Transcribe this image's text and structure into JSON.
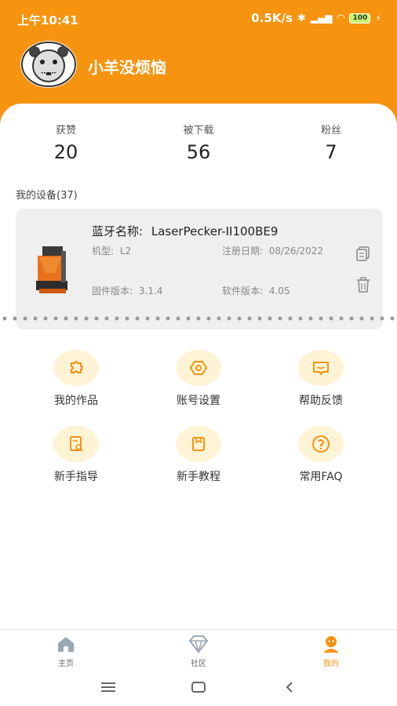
{
  "status_bar": {
    "time": "上午10:41",
    "network_speed": "0.5K/s",
    "battery": "100"
  },
  "profile": {
    "username": "小羊没烦恼"
  },
  "stats": [
    {
      "label": "获赞",
      "value": "20"
    },
    {
      "label": "被下载",
      "value": "56"
    },
    {
      "label": "粉丝",
      "value": "7"
    }
  ],
  "devices": {
    "section_title": "我的设备(37)",
    "card": {
      "bluetooth_label": "蓝牙名称:",
      "bluetooth_name": "LaserPecker-II100BE9",
      "model_label": "机型:",
      "model": "L2",
      "reg_date_label": "注册日期:",
      "reg_date": "08/26/2022",
      "firmware_label": "固件版本:",
      "firmware": "3.1.4",
      "software_label": "软件版本:",
      "software": "4.05"
    }
  },
  "menu": [
    {
      "label": "我的作品",
      "icon": "puzzle-icon"
    },
    {
      "label": "账号设置",
      "icon": "settings-icon"
    },
    {
      "label": "帮助反馈",
      "icon": "feedback-icon"
    },
    {
      "label": "新手指导",
      "icon": "guide-icon"
    },
    {
      "label": "新手教程",
      "icon": "tutorial-icon"
    },
    {
      "label": "常用FAQ",
      "icon": "faq-icon"
    }
  ],
  "bottom_nav": [
    {
      "label": "主页",
      "icon": "home-icon"
    },
    {
      "label": "社区",
      "icon": "diamond-icon"
    },
    {
      "label": "我的",
      "icon": "profile-icon",
      "active": true
    }
  ],
  "colors": {
    "brand": "#F6930F",
    "icon_bg": "#FFF3D6"
  }
}
